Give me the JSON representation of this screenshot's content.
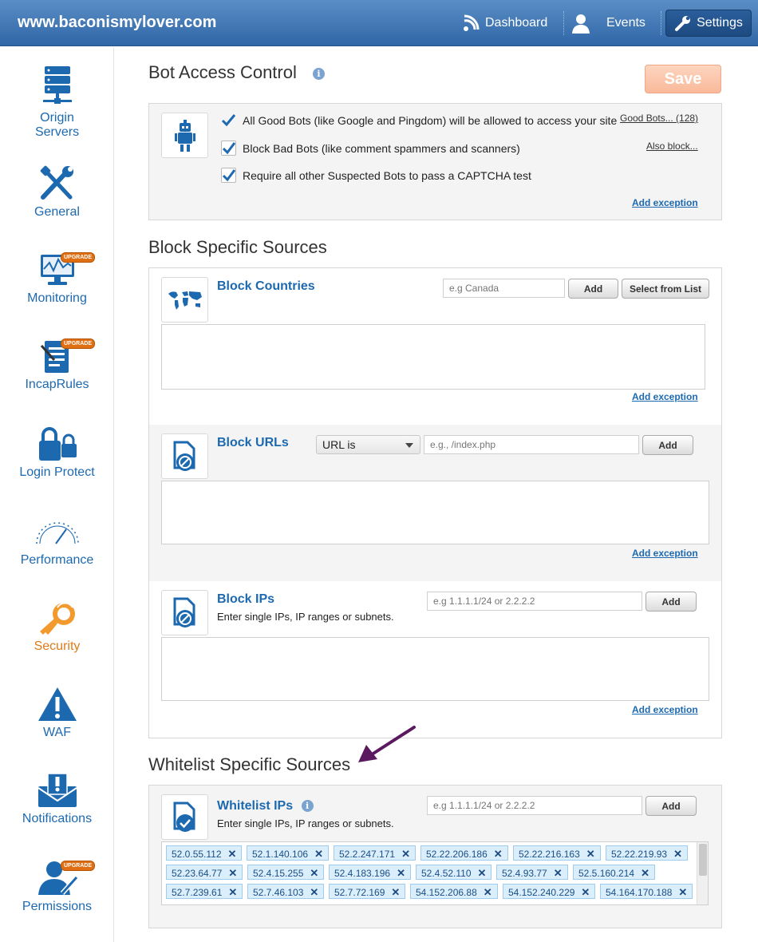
{
  "header": {
    "site_title": "www.baconismylover.com",
    "nav": {
      "dashboard": "Dashboard",
      "events": "Events",
      "settings": "Settings"
    }
  },
  "sidebar": {
    "items": [
      {
        "label": "Origin Servers",
        "icon": "server-icon"
      },
      {
        "label": "General",
        "icon": "tools-icon"
      },
      {
        "label": "Monitoring",
        "icon": "monitor-icon",
        "badge": "UPGRADE"
      },
      {
        "label": "IncapRules",
        "icon": "rules-icon",
        "badge": "UPGRADE"
      },
      {
        "label": "Login Protect",
        "icon": "lock-icon"
      },
      {
        "label": "Performance",
        "icon": "gauge-icon"
      },
      {
        "label": "Security",
        "icon": "security-key-icon",
        "active": true
      },
      {
        "label": "WAF",
        "icon": "warning-icon"
      },
      {
        "label": "Notifications",
        "icon": "envelope-icon"
      },
      {
        "label": "Permissions",
        "icon": "user-pen-icon",
        "badge": "UPGRADE"
      }
    ]
  },
  "bot_access": {
    "title": "Bot Access Control",
    "save_label": "Save",
    "options": [
      "All Good Bots (like Google and Pingdom) will be allowed to access your site",
      "Block Bad Bots (like comment spammers and scanners)",
      "Require all other Suspected Bots to pass a CAPTCHA test"
    ],
    "good_bots_link": "Good Bots... (128)",
    "also_block_link": "Also block...",
    "add_exception": "Add exception"
  },
  "block_sources": {
    "title": "Block Specific Sources",
    "countries": {
      "title": "Block Countries",
      "placeholder": "e.g Canada",
      "add_label": "Add",
      "select_label": "Select from List",
      "add_exception": "Add exception"
    },
    "urls": {
      "title": "Block URLs",
      "select_value": "URL is",
      "placeholder": "e.g., /index.php",
      "add_label": "Add",
      "add_exception": "Add exception"
    },
    "ips": {
      "title": "Block IPs",
      "subtitle": "Enter single IPs, IP ranges or subnets.",
      "placeholder": "e.g 1.1.1.1/24 or 2.2.2.2",
      "add_label": "Add",
      "add_exception": "Add exception"
    }
  },
  "whitelist": {
    "title": "Whitelist Specific Sources",
    "ips": {
      "title": "Whitelist IPs",
      "subtitle": "Enter single IPs, IP ranges or subnets.",
      "placeholder": "e.g 1.1.1.1/24 or 2.2.2.2",
      "add_label": "Add",
      "entries": [
        "52.0.55.112",
        "52.1.140.106",
        "52.2.247.171",
        "52.22.206.186",
        "52.22.216.163",
        "52.22.219.93",
        "52.23.64.77",
        "52.4.15.255",
        "52.4.183.196",
        "52.4.52.110",
        "52.4.93.77",
        "52.5.160.214",
        "52.7.239.61",
        "52.7.46.103",
        "52.7.72.169",
        "54.152.206.88",
        "54.152.240.229",
        "54.164.170.188"
      ],
      "remove_glyph": "✕"
    }
  },
  "colors": {
    "header": "#2f66a6",
    "link": "#1d69b0",
    "active": "#e07a16",
    "tag_bg": "#dbeefb",
    "arrow": "#5b1a60"
  }
}
